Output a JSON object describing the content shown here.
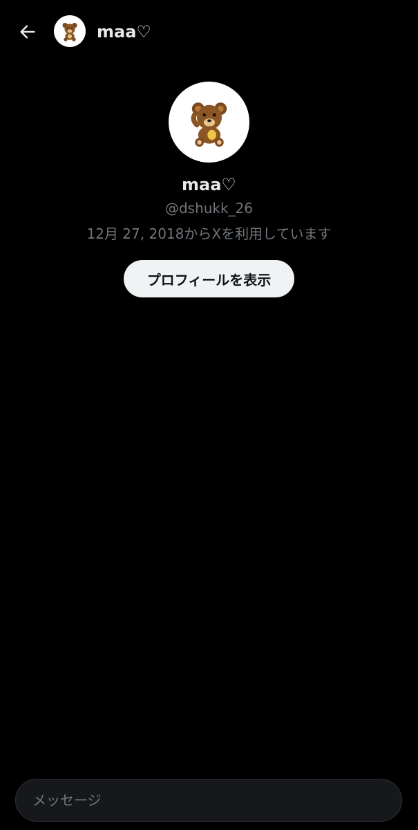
{
  "header": {
    "back_icon": "arrow-left-icon",
    "avatar_icon": "teddy-bear-avatar",
    "name": "maa♡"
  },
  "profile": {
    "avatar_icon": "teddy-bear-avatar",
    "name": "maa♡",
    "handle": "@dshukk_26",
    "joined": "12月 27, 2018からXを利用しています",
    "view_profile_label": "プロフィールを表示"
  },
  "composer": {
    "placeholder": "メッセージ",
    "value": ""
  },
  "colors": {
    "background": "#000000",
    "primary_text": "#e7e9ea",
    "secondary_text": "#71767b",
    "button_bg": "#eff3f4",
    "button_text": "#0f1419",
    "composer_bg": "#16181c"
  }
}
